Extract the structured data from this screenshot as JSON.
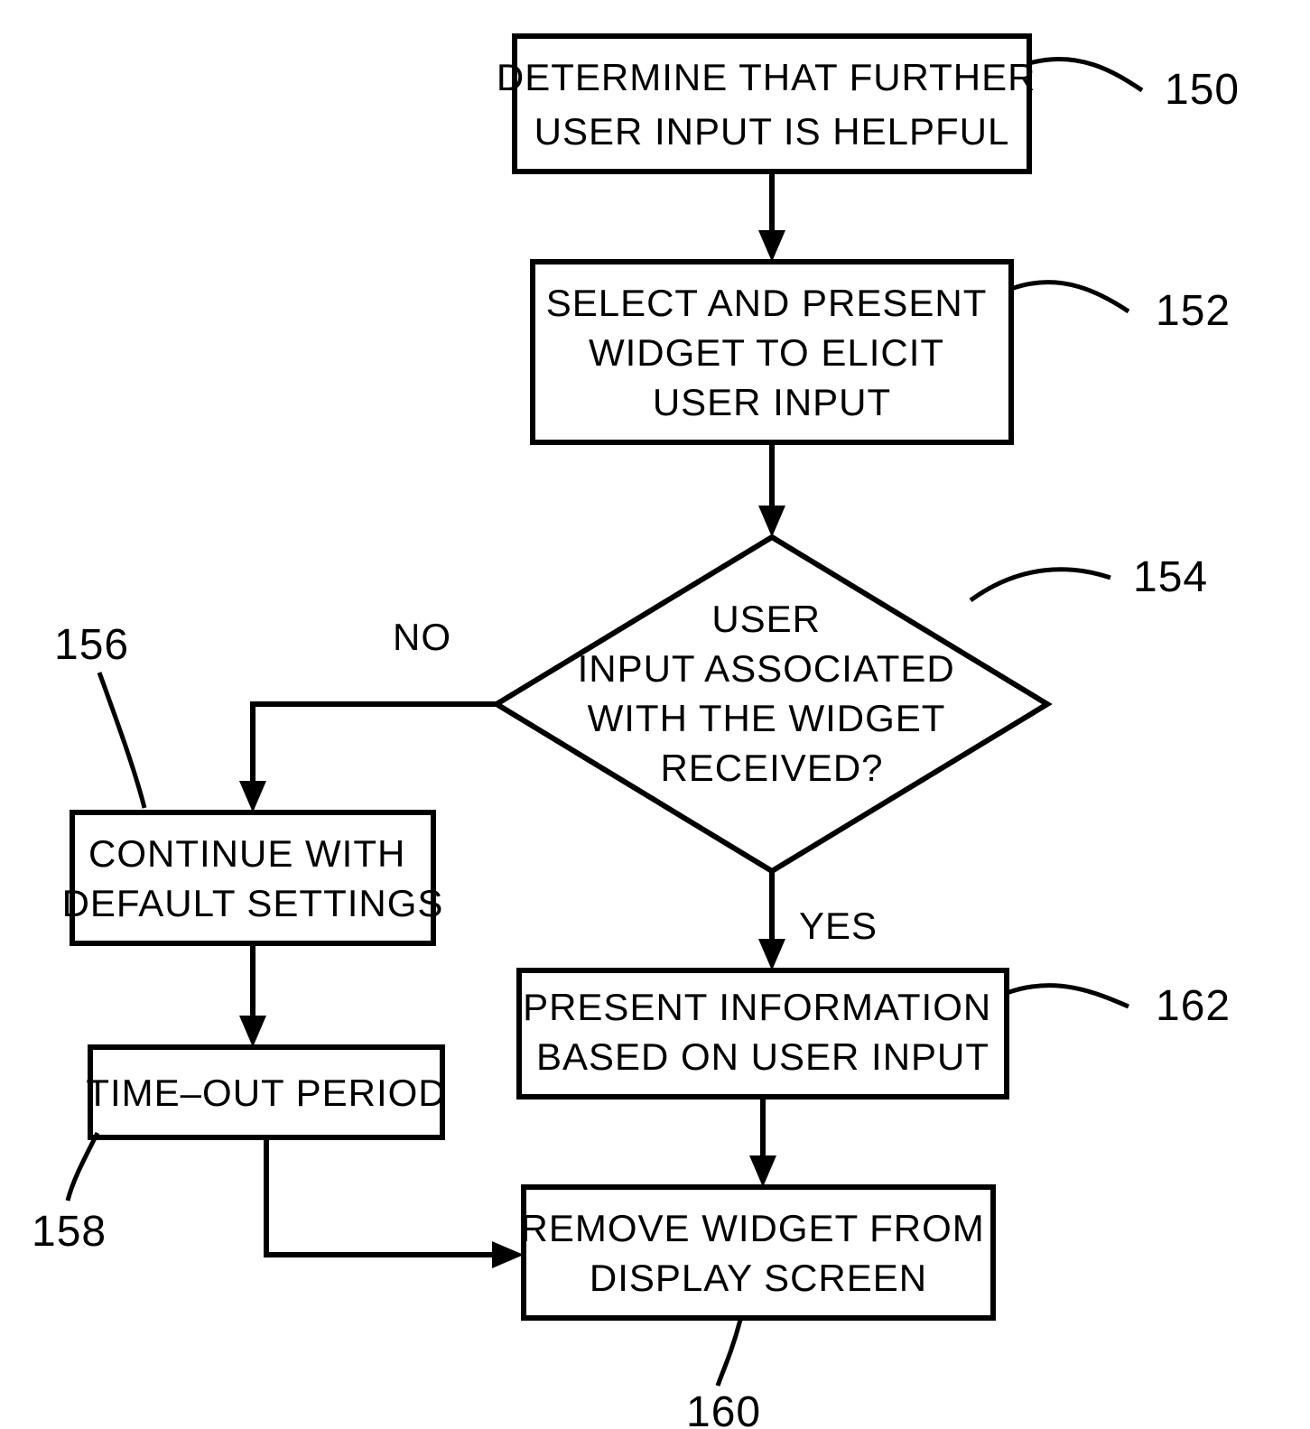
{
  "nodes": {
    "n150": {
      "l1": "DETERMINE THAT FURTHER",
      "l2": "USER INPUT IS HELPFUL",
      "ref": "150"
    },
    "n152": {
      "l1": "SELECT AND PRESENT",
      "l2": "WIDGET TO ELICIT",
      "l3": "USER INPUT",
      "ref": "152"
    },
    "n154": {
      "l1": "USER",
      "l2": "INPUT ASSOCIATED",
      "l3": "WITH THE WIDGET",
      "l4": "RECEIVED?",
      "ref": "154"
    },
    "n156": {
      "l1": "CONTINUE WITH",
      "l2": "DEFAULT SETTINGS",
      "ref": "156"
    },
    "n158": {
      "l1": "TIME–OUT PERIOD",
      "ref": "158"
    },
    "n160": {
      "l1": "REMOVE WIDGET FROM",
      "l2": "DISPLAY SCREEN",
      "ref": "160"
    },
    "n162": {
      "l1": "PRESENT INFORMATION",
      "l2": "BASED ON USER INPUT",
      "ref": "162"
    }
  },
  "edges": {
    "no": "NO",
    "yes": "YES"
  }
}
